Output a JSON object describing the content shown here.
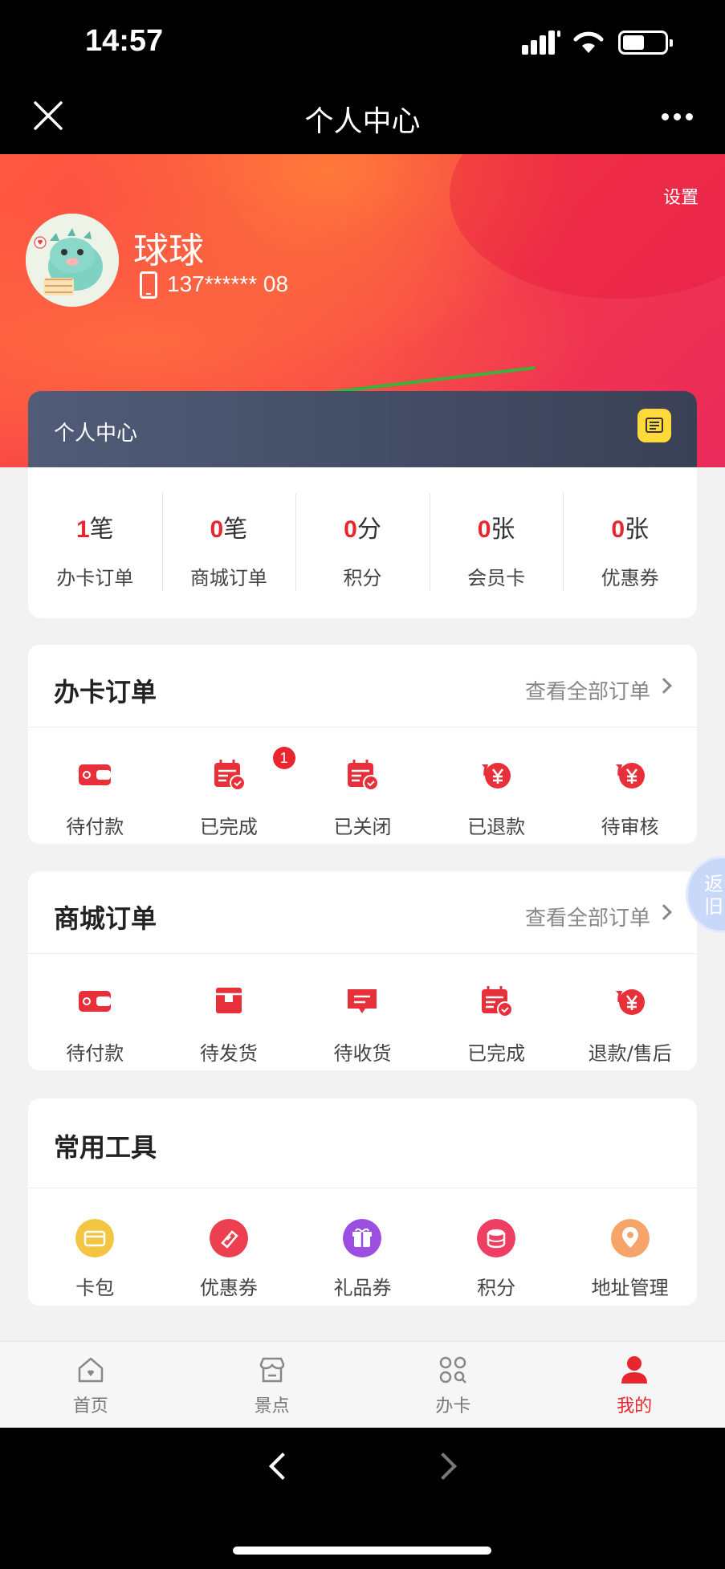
{
  "status": {
    "time": "14:57"
  },
  "nav": {
    "title": "个人中心"
  },
  "header": {
    "settings_label": "设置",
    "user_name": "球球",
    "phone": "137****** 08"
  },
  "member_card": {
    "title": "个人中心"
  },
  "stats": [
    {
      "value": "1",
      "unit": "笔",
      "label": "办卡订单"
    },
    {
      "value": "0",
      "unit": "笔",
      "label": "商城订单"
    },
    {
      "value": "0",
      "unit": "分",
      "label": "积分"
    },
    {
      "value": "0",
      "unit": "张",
      "label": "会员卡"
    },
    {
      "value": "0",
      "unit": "张",
      "label": "优惠券"
    }
  ],
  "card_orders": {
    "title": "办卡订单",
    "view_all": "查看全部订单",
    "items": [
      {
        "label": "待付款",
        "icon": "wallet-icon"
      },
      {
        "label": "已完成",
        "icon": "calendar-check-icon",
        "badge": "1"
      },
      {
        "label": "已关闭",
        "icon": "calendar-check-icon"
      },
      {
        "label": "已退款",
        "icon": "yen-refund-icon"
      },
      {
        "label": "待审核",
        "icon": "yen-refund-icon"
      }
    ]
  },
  "mall_orders": {
    "title": "商城订单",
    "view_all": "查看全部订单",
    "items": [
      {
        "label": "待付款",
        "icon": "wallet-icon"
      },
      {
        "label": "待发货",
        "icon": "package-icon"
      },
      {
        "label": "待收货",
        "icon": "message-icon"
      },
      {
        "label": "已完成",
        "icon": "calendar-check-icon"
      },
      {
        "label": "退款/售后",
        "icon": "yen-refund-icon"
      }
    ]
  },
  "tools": {
    "title": "常用工具",
    "items": [
      {
        "label": "卡包",
        "icon": "card-wallet-icon",
        "color": "#f2b12e"
      },
      {
        "label": "优惠券",
        "icon": "coupon-icon",
        "color": "#ec3f4f"
      },
      {
        "label": "礼品券",
        "icon": "gift-icon",
        "color": "#9b4ee0"
      },
      {
        "label": "积分",
        "icon": "coins-icon",
        "color": "#ee3e62"
      },
      {
        "label": "地址管理",
        "icon": "location-icon",
        "color": "#f5a56a"
      }
    ]
  },
  "floating": {
    "label": "返旧"
  },
  "tabbar": [
    {
      "label": "首页",
      "icon": "home-icon",
      "active": false
    },
    {
      "label": "景点",
      "icon": "shop-icon",
      "active": false
    },
    {
      "label": "办卡",
      "icon": "grid-icon",
      "active": false
    },
    {
      "label": "我的",
      "icon": "user-icon",
      "active": true
    }
  ],
  "colors": {
    "accent": "#e8262f",
    "header_start": "#ff5a40",
    "header_end": "#ea2a5a",
    "member_card": "#444c64"
  }
}
